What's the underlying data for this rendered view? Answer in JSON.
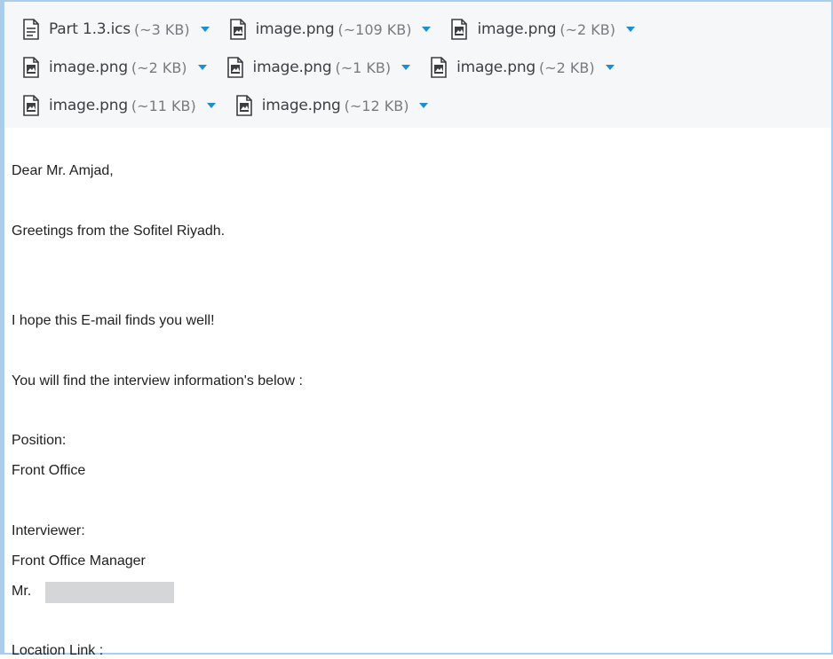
{
  "attachments": [
    {
      "name": "Part 1.3.ics",
      "size": "(~3 KB)",
      "icon": "calendar-file-icon"
    },
    {
      "name": "image.png",
      "size": "(~109 KB)",
      "icon": "image-file-icon"
    },
    {
      "name": "image.png",
      "size": "(~2 KB)",
      "icon": "image-file-icon"
    },
    {
      "name": "image.png",
      "size": "(~2 KB)",
      "icon": "image-file-icon"
    },
    {
      "name": "image.png",
      "size": "(~1 KB)",
      "icon": "image-file-icon"
    },
    {
      "name": "image.png",
      "size": "(~2 KB)",
      "icon": "image-file-icon"
    },
    {
      "name": "image.png",
      "size": "(~11 KB)",
      "icon": "image-file-icon"
    },
    {
      "name": "image.png",
      "size": "(~12 KB)",
      "icon": "image-file-icon"
    }
  ],
  "email": {
    "salutation": "Dear Mr. Amjad,",
    "greeting": "Greetings from the  Sofitel Riyadh.",
    "wellwish": "I hope this E-mail finds you well!",
    "intro": "You will find the interview information's below :",
    "position_label": "Position:",
    "position_value": "Front Office",
    "interviewer_label": "Interviewer:",
    "interviewer_value": "Front Office Manager",
    "interviewer_name_prefix": "Mr.",
    "location_label": "Location Link :"
  },
  "colors": {
    "frame": "#a9cdea",
    "attachment_bg": "#f6f7f8",
    "dropdown": "#1a8fd8"
  }
}
